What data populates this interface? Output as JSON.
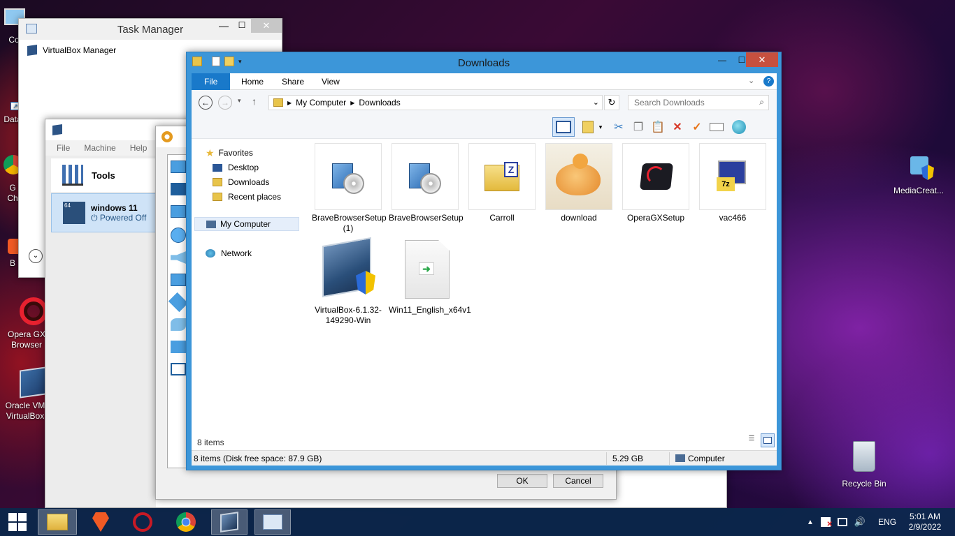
{
  "desktop": {
    "icons": [
      {
        "label": "Co",
        "id": "computer"
      },
      {
        "label": "Data",
        "id": "data"
      },
      {
        "label": "G\nCh",
        "id": "chrome"
      },
      {
        "label": "B",
        "id": "brave"
      },
      {
        "label": "Opera GX Browser",
        "id": "operagx"
      },
      {
        "label": "Oracle VM VirtualBox",
        "id": "vbox"
      },
      {
        "label": "MediaCreat...",
        "id": "mediacreation"
      },
      {
        "label": "Recycle Bin",
        "id": "recyclebin"
      }
    ]
  },
  "task_manager": {
    "title": "Task Manager",
    "row": "VirtualBox Manager"
  },
  "vbox_manager": {
    "menu": [
      "File",
      "Machine",
      "Help"
    ],
    "tools_label": "Tools",
    "vm_name": "windows 11",
    "vm_state": "Powered Off",
    "vm_badge": "64"
  },
  "settings_dialog": {
    "ok_label": "OK",
    "cancel_label": "Cancel"
  },
  "explorer": {
    "title": "Downloads",
    "tabs": [
      "File",
      "Home",
      "Share",
      "View"
    ],
    "address": {
      "root": "My Computer",
      "folder": "Downloads"
    },
    "search_placeholder": "Search Downloads",
    "nav": {
      "favorites": "Favorites",
      "fav_items": [
        "Desktop",
        "Downloads",
        "Recent places"
      ],
      "computer": "My Computer",
      "network": "Network"
    },
    "files": [
      {
        "name": "BraveBrowserSetup (1)",
        "icon": "installer-icon"
      },
      {
        "name": "BraveBrowserSetup",
        "icon": "installer-icon"
      },
      {
        "name": "Carroll",
        "icon": "zip-folder-icon"
      },
      {
        "name": "download",
        "icon": "image-thumbnail"
      },
      {
        "name": "OperaGXSetup",
        "icon": "operagx-icon"
      },
      {
        "name": "vac466",
        "icon": "7zip-icon"
      },
      {
        "name": "VirtualBox-6.1.32-149290-Win",
        "icon": "virtualbox-icon"
      },
      {
        "name": "Win11_English_x64v1",
        "icon": "shortcut-file-icon"
      }
    ],
    "item_count": "8 items",
    "status_left": "8 items (Disk free space: 87.9 GB)",
    "status_size": "5.29 GB",
    "status_location": "Computer"
  },
  "taskbar": {
    "lang": "ENG",
    "time": "5:01 AM",
    "date": "2/9/2022"
  },
  "colors": {
    "explorer_frame": "#3c96d9",
    "file_tab": "#1979ca",
    "close_button": "#c7503f",
    "taskbar": "#0a284b"
  }
}
